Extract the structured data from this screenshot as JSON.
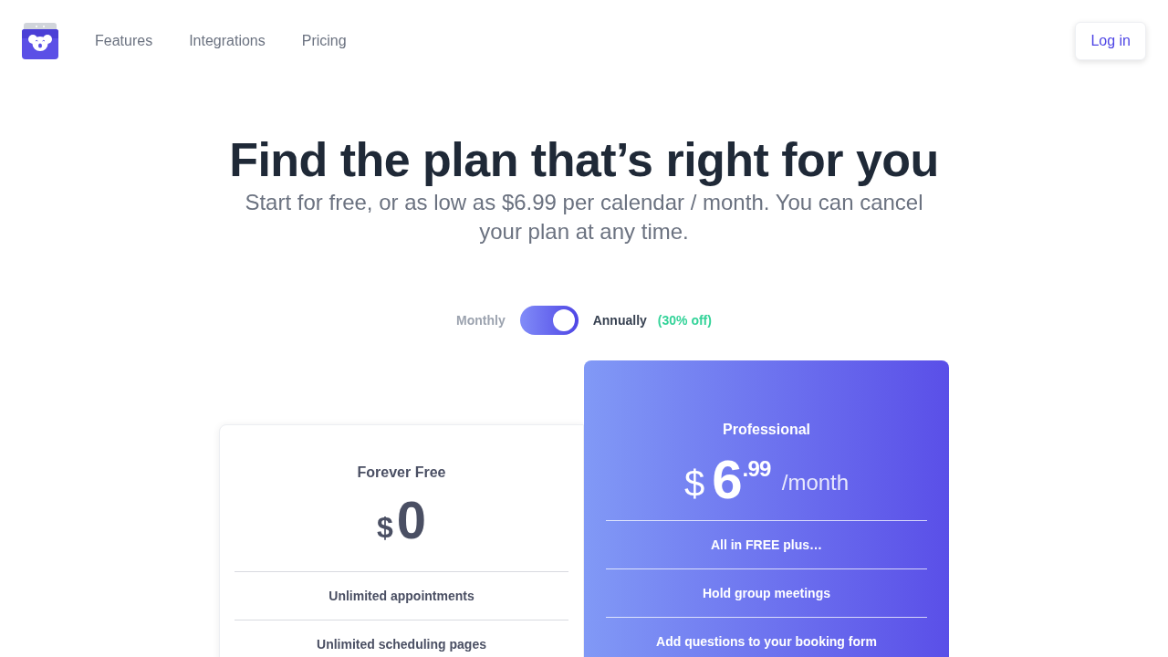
{
  "nav": {
    "links": [
      {
        "label": "Features"
      },
      {
        "label": "Integrations"
      },
      {
        "label": "Pricing"
      }
    ],
    "login": "Log in"
  },
  "hero": {
    "title": "Find the plan that’s right for you",
    "subtitle": "Start for free, or as low as $6.99 per calendar / month. You can cancel your plan at any time."
  },
  "billing": {
    "monthly_label": "Monthly",
    "annual_label": "Annually",
    "discount": "(30% off)",
    "annual": true
  },
  "plans": [
    {
      "name": "Forever Free",
      "featured": false,
      "price": {
        "currency": "$",
        "amount": "0"
      },
      "features": [
        "Unlimited appointments",
        "Unlimited scheduling pages"
      ]
    },
    {
      "name": "Professional",
      "featured": true,
      "price": {
        "currency": "$",
        "amount": "6",
        "cents": ".99",
        "period": "/month"
      },
      "features": [
        "All in FREE plus…",
        "Hold group meetings",
        "Add questions to your booking form"
      ]
    }
  ]
}
